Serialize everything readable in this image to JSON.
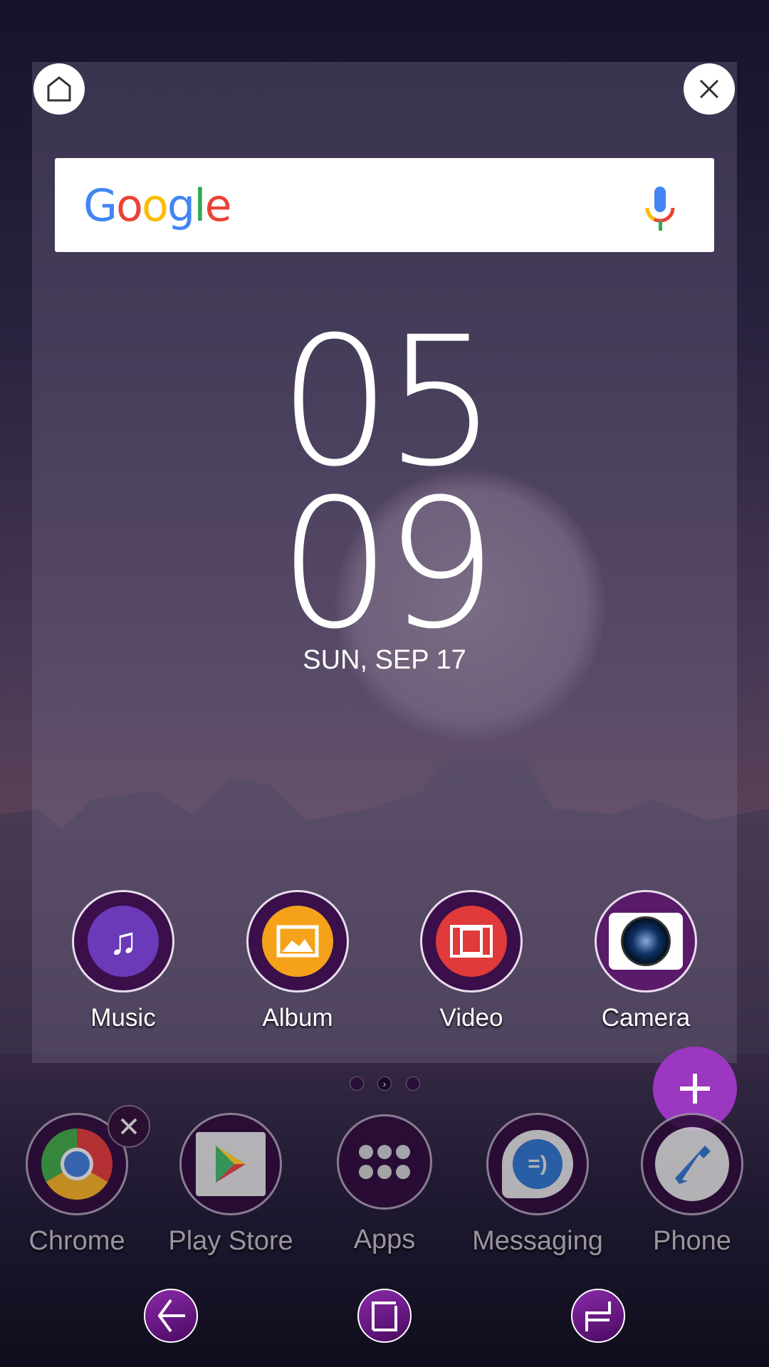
{
  "panel": {
    "home_icon": "home-icon",
    "close_icon": "close-icon"
  },
  "search": {
    "logo": "Google",
    "mic_icon": "mic-icon"
  },
  "clock": {
    "hours": "05",
    "minutes": "09",
    "date": "SUN, SEP 17"
  },
  "apps": [
    {
      "label": "Music",
      "icon": "music-note-icon",
      "color": "#6a3ab8"
    },
    {
      "label": "Album",
      "icon": "picture-icon",
      "color": "#f5a21a"
    },
    {
      "label": "Video",
      "icon": "film-icon",
      "color": "#e03a3a"
    },
    {
      "label": "Camera",
      "icon": "camera-icon",
      "color": "#ffffff"
    }
  ],
  "page_indicator": {
    "count": 3,
    "current": 2
  },
  "fab": {
    "icon": "plus-icon",
    "color": "#9b37c0"
  },
  "dock": [
    {
      "label": "Chrome"
    },
    {
      "label": "Play Store"
    },
    {
      "label": "Apps"
    },
    {
      "label": "Messaging"
    },
    {
      "label": "Phone"
    }
  ],
  "nav": {
    "back": "back-icon",
    "home": "home-square-icon",
    "recents": "recents-icon"
  }
}
